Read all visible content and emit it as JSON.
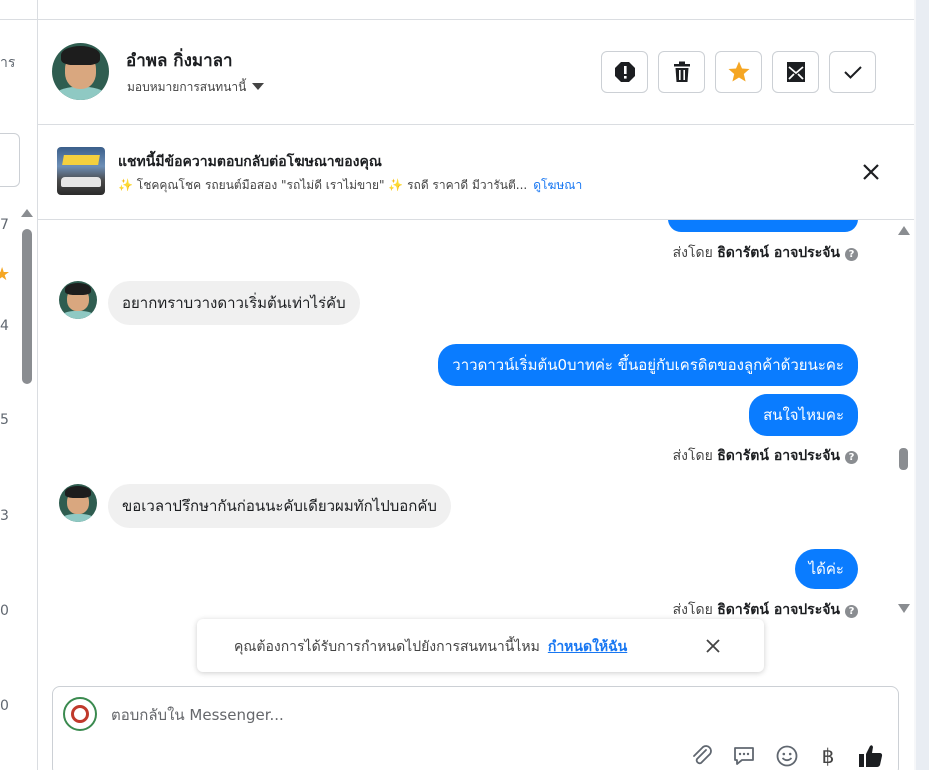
{
  "left_panel": {
    "snippets": [
      "าร",
      "7",
      "4",
      "5",
      "3",
      "0",
      "0"
    ]
  },
  "header": {
    "contact_name": "อำพล กิ่งมาลา",
    "assign_label": "มอบหมายการสนทนานี้",
    "actions": [
      {
        "name": "spam-button",
        "icon": "exclamation-octagon-icon"
      },
      {
        "name": "delete-button",
        "icon": "trash-icon"
      },
      {
        "name": "star-button",
        "icon": "star-icon"
      },
      {
        "name": "mark-unread-button",
        "icon": "envelope-icon"
      },
      {
        "name": "mark-done-button",
        "icon": "check-icon"
      }
    ]
  },
  "ad_banner": {
    "title": "แชทนี้มีข้อความตอบกลับต่อโฆษณาของคุณ",
    "snippet": "✨ โชคคุณโชค รถยนต์มือสอง \"รถไม่ดี เราไม่ขาย\" ✨ รถดี ราคาดี มีวารันตี...",
    "link": "ดูโฆษณา"
  },
  "conversation": {
    "sent_by_prefix": "ส่งโดย",
    "agent_name": "ธิดารัตน์ อาจประจัน",
    "messages": [
      {
        "from": "customer",
        "text": "อยากทราบวางดาวเริ่มต้นเท่าไร่คับ"
      },
      {
        "from": "page",
        "text": "วาวดาวน์เริ่มต้น0บาทค่ะ ขึ้นอยู่กับเครดิตของลูกค้าด้วยนะคะ"
      },
      {
        "from": "page",
        "text": "สนใจไหมคะ"
      },
      {
        "from": "customer",
        "text": "ขอเวลาปรึกษากันก่อนนะคับเดียวผมทักไปบอกคับ"
      },
      {
        "from": "page",
        "text": "ได้ค่ะ"
      }
    ]
  },
  "assign_prompt": {
    "text": "คุณต้องการได้รับการกำหนดไปยังการสนทนานี้ไหม",
    "action": "กำหนดให้ฉัน"
  },
  "composer": {
    "placeholder": "ตอบกลับใน Messenger...",
    "tools": [
      "paperclip-icon",
      "saved-reply-icon",
      "emoji-icon",
      "baht-icon",
      "thumbs-up-icon"
    ]
  },
  "colors": {
    "outgoing_bubble": "#0a7cff",
    "incoming_bubble": "#f0f0f0",
    "link": "#1877f2",
    "star": "#f5a623"
  }
}
